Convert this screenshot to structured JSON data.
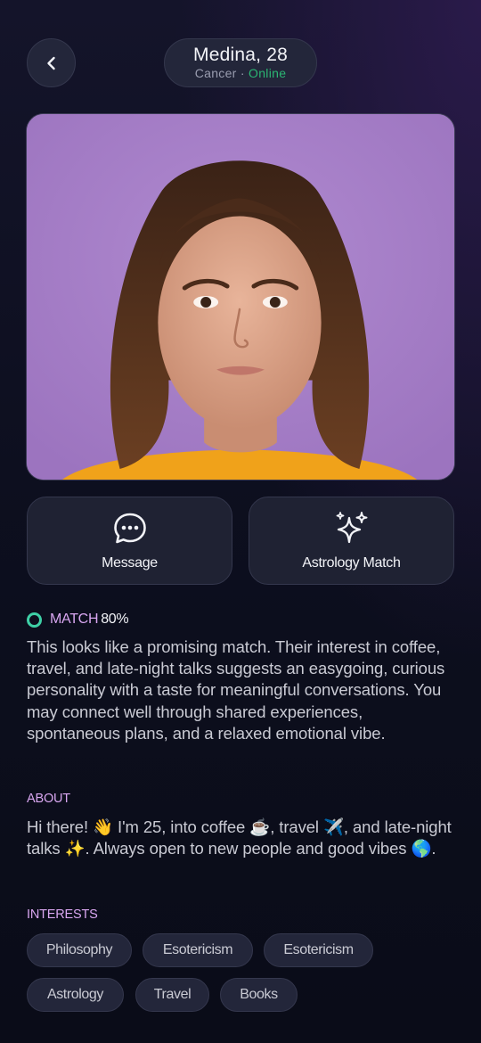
{
  "header": {
    "name": "Medina, 28",
    "sign": "Cancer",
    "separator": "·",
    "status": "Online"
  },
  "actions": {
    "message_label": "Message",
    "astrology_label": "Astrology Match"
  },
  "match": {
    "label": "MATCH",
    "value": "80%",
    "description": "This looks like a promising match. Their interest in coffee, travel, and late-night talks suggests an easygoing, curious personality with a taste for meaningful conversations. You may connect well through shared experiences, spontaneous plans, and a relaxed emotional vibe."
  },
  "about": {
    "label": "ABOUT",
    "text": "Hi there! 👋 I'm 25, into coffee ☕, travel ✈️, and late-night talks ✨. Always open to new people and good vibes 🌎."
  },
  "interests": {
    "label": "INTERESTS",
    "items": [
      "Philosophy",
      "Esotericism",
      "Esotericism",
      "Astrology",
      "Travel",
      "Books"
    ]
  },
  "colors": {
    "accent": "#d8a6f0",
    "online": "#2bb673",
    "match_ring": "#3ecfa6",
    "photo_bg": "#a77fc6"
  },
  "icons": [
    "chevron-left-icon",
    "chat-bubble-icon",
    "sparkles-icon"
  ]
}
